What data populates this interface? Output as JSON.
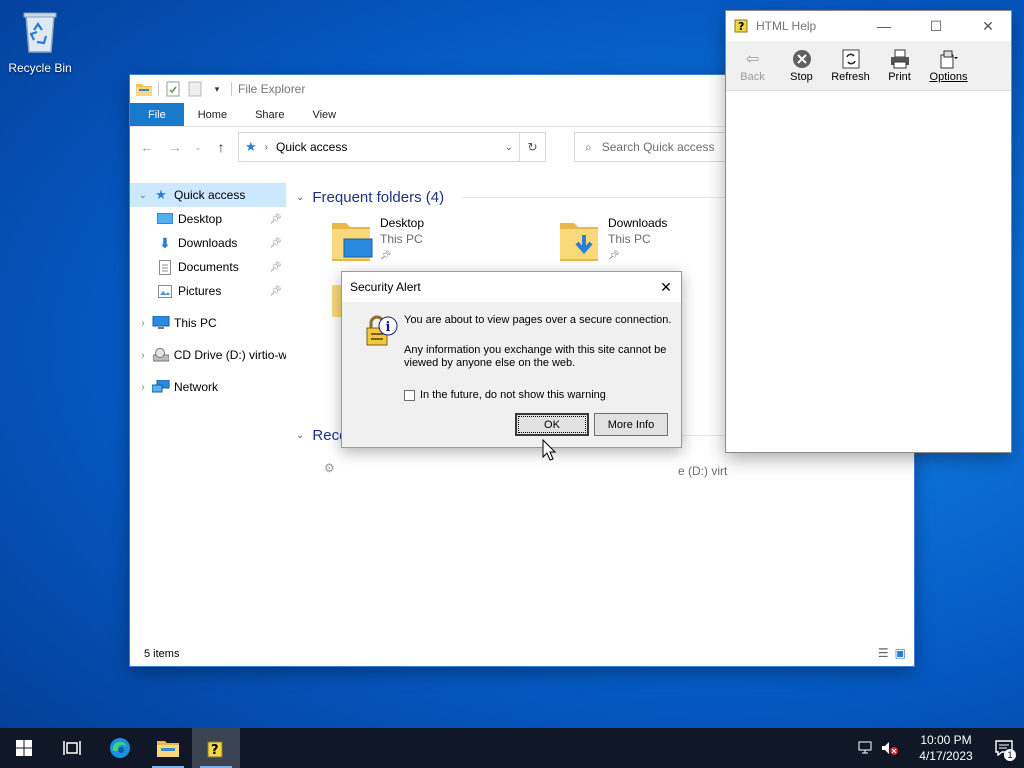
{
  "desktop": {
    "recycle_bin_label": "Recycle Bin"
  },
  "file_explorer": {
    "title": "File Explorer",
    "ribbon_tabs": [
      "File",
      "Home",
      "Share",
      "View"
    ],
    "address": "Quick access",
    "search_placeholder": "Search Quick access",
    "nav": {
      "quick_access": "Quick access",
      "desktop": "Desktop",
      "downloads": "Downloads",
      "documents": "Documents",
      "pictures": "Pictures",
      "this_pc": "This PC",
      "cd_drive": "CD Drive (D:) virtio-w",
      "network": "Network"
    },
    "frequent_folders_heading": "Frequent folders (4)",
    "recent_heading": "Rece",
    "recent_partial_text": "e (D:) virt",
    "folders": [
      {
        "name": "Desktop",
        "location": "This PC"
      },
      {
        "name": "Downloads",
        "location": "This PC"
      }
    ],
    "status": "5 items"
  },
  "html_help": {
    "title": "HTML Help",
    "toolbar": {
      "back": "Back",
      "stop": "Stop",
      "refresh": "Refresh",
      "print": "Print",
      "options": "Options"
    }
  },
  "security_alert": {
    "title": "Security Alert",
    "message1": "You are about to view pages over a secure connection.",
    "message2": "Any information you exchange with this site cannot be viewed by anyone else on the web.",
    "checkbox_label": "In the future, do not show this warning",
    "checkbox_checked": false,
    "ok_label": "OK",
    "more_info_label": "More Info"
  },
  "taskbar": {
    "time": "10:00 PM",
    "date": "4/17/2023",
    "notification_count": "1"
  },
  "colors": {
    "accent": "#1979ca",
    "nav_selected": "#cce8ff",
    "taskbar": "#101827",
    "group_heading": "#1e3287"
  }
}
